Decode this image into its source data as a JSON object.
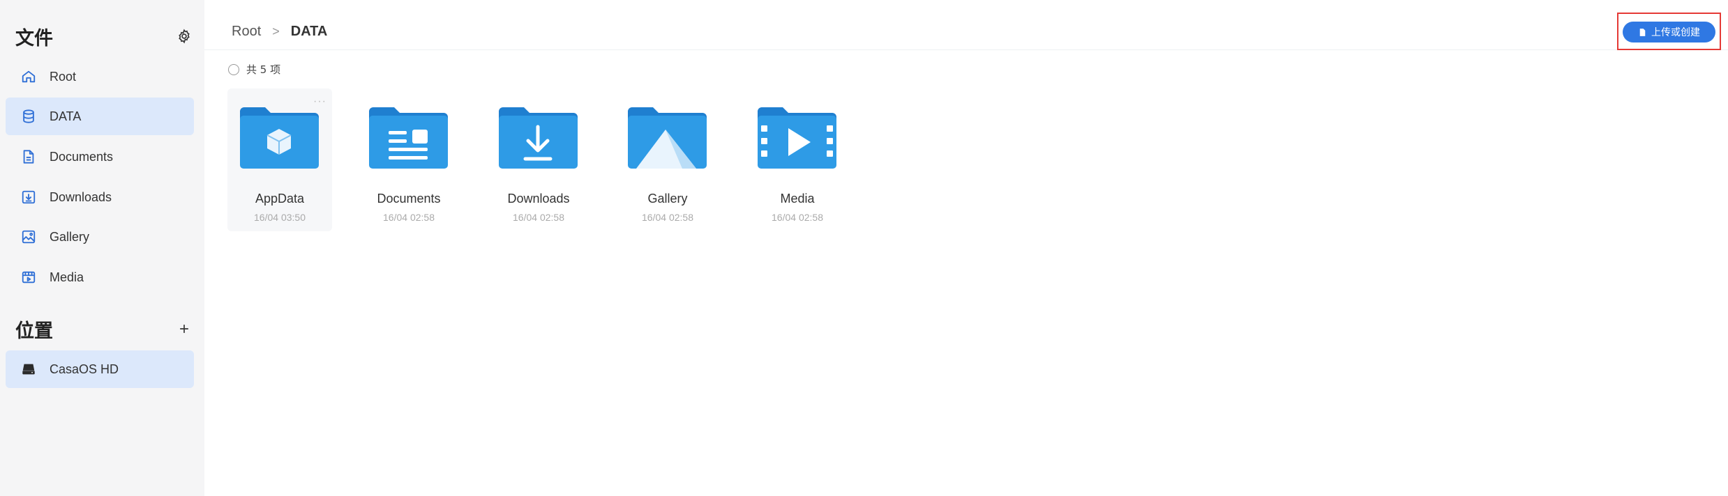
{
  "sidebar": {
    "files_title": "文件",
    "nav": [
      {
        "label": "Root",
        "icon": "home-icon"
      },
      {
        "label": "DATA",
        "icon": "database-icon",
        "active": true
      },
      {
        "label": "Documents",
        "icon": "document-icon"
      },
      {
        "label": "Downloads",
        "icon": "download-icon"
      },
      {
        "label": "Gallery",
        "icon": "gallery-icon"
      },
      {
        "label": "Media",
        "icon": "media-icon"
      }
    ],
    "locations_title": "位置",
    "locations": [
      {
        "label": "CasaOS HD",
        "icon": "drive-icon",
        "active": true
      }
    ]
  },
  "breadcrumb": {
    "root": "Root",
    "separator": ">",
    "current": "DATA"
  },
  "toolbar": {
    "upload_label": "上传或创建"
  },
  "list": {
    "count_label": "共 5 项",
    "items": [
      {
        "name": "AppData",
        "date": "16/04 03:50",
        "icon": "appdata-folder-icon"
      },
      {
        "name": "Documents",
        "date": "16/04 02:58",
        "icon": "documents-folder-icon"
      },
      {
        "name": "Downloads",
        "date": "16/04 02:58",
        "icon": "downloads-folder-icon"
      },
      {
        "name": "Gallery",
        "date": "16/04 02:58",
        "icon": "gallery-folder-icon"
      },
      {
        "name": "Media",
        "date": "16/04 02:58",
        "icon": "media-folder-icon"
      }
    ]
  },
  "colors": {
    "accent": "#2f78e3",
    "sidebar_bg": "#f5f5f6",
    "active_bg": "#dce8fb",
    "folder_back": "#1f7fd0",
    "folder_front": "#2e9be6",
    "highlight": "#e53935"
  }
}
